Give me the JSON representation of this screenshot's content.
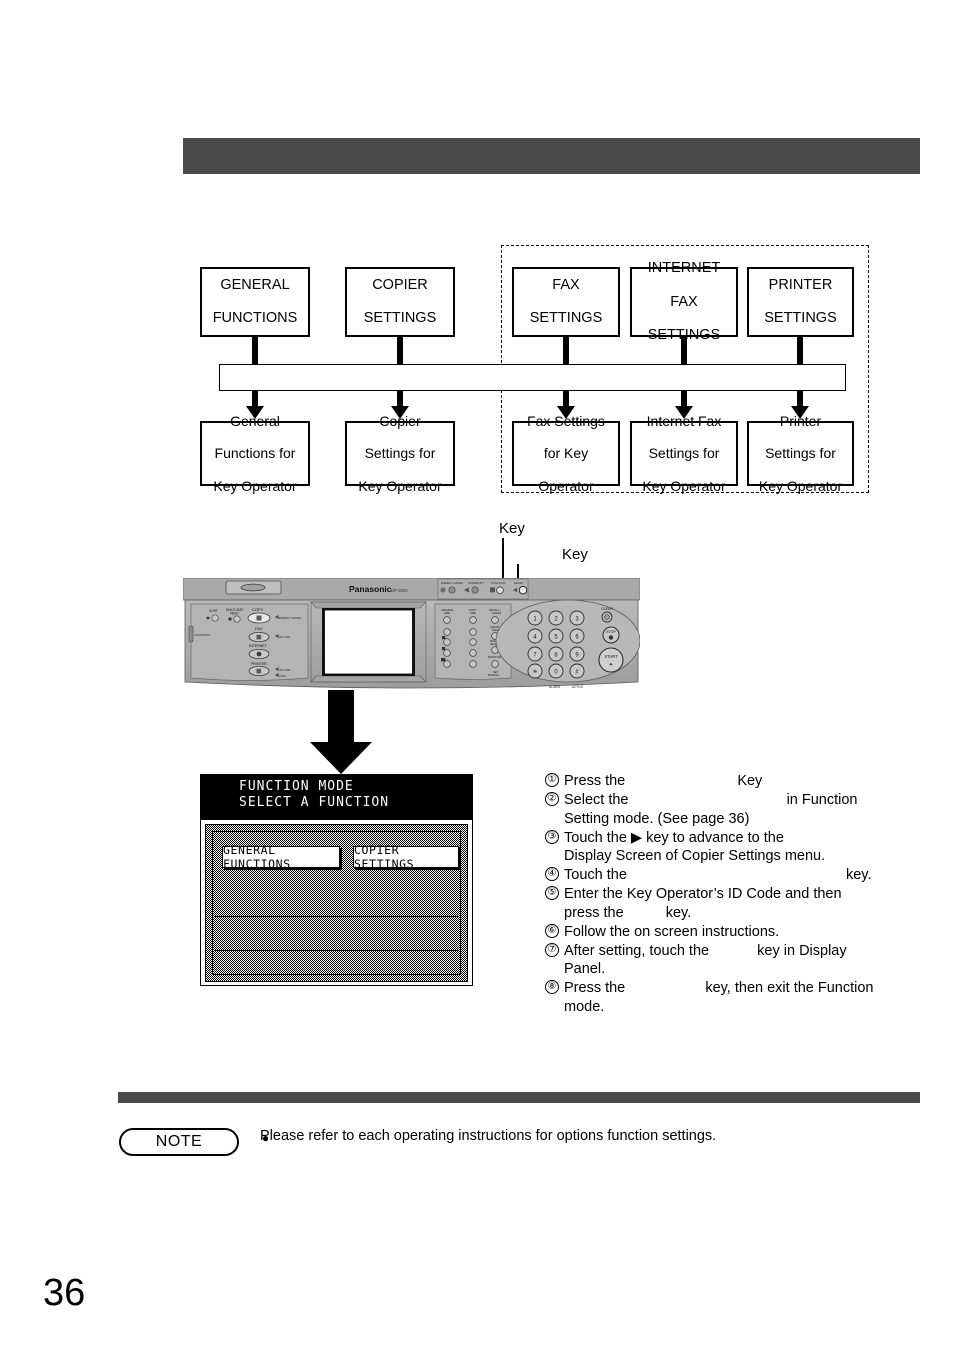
{
  "header": {
    "title": ""
  },
  "flowchart": {
    "top_boxes": [
      {
        "id": "general-functions",
        "lines": [
          "GENERAL",
          "FUNCTIONS"
        ]
      },
      {
        "id": "copier-settings",
        "lines": [
          "COPIER",
          "SETTINGS"
        ]
      },
      {
        "id": "fax-settings",
        "lines": [
          "FAX",
          "SETTINGS"
        ]
      },
      {
        "id": "internet-fax-settings",
        "lines": [
          "INTERNET",
          "FAX",
          "SETTINGS"
        ]
      },
      {
        "id": "printer-settings",
        "lines": [
          "PRINTER",
          "SETTINGS"
        ]
      }
    ],
    "bottom_boxes": [
      {
        "id": "general-functions-ko",
        "lines": [
          "General",
          "Functions for",
          "Key Operator"
        ]
      },
      {
        "id": "copier-settings-ko",
        "lines": [
          "Copier",
          "Settings for",
          "Key Operator"
        ]
      },
      {
        "id": "fax-settings-ko",
        "lines": [
          "Fax Settings",
          "for Key",
          "Operator"
        ]
      },
      {
        "id": "internet-fax-settings-ko",
        "lines": [
          "Internet Fax",
          "Settings for",
          "Key Operator"
        ]
      },
      {
        "id": "printer-settings-ko",
        "lines": [
          "Printer",
          "Settings for",
          "Key Operator"
        ]
      }
    ],
    "bus_label": ""
  },
  "callouts": {
    "function_key_label": "Key",
    "reset_key_label": "Key"
  },
  "panel": {
    "brand": "Panasonic",
    "model": "DP-3000",
    "mode_keys": [
      "COPY",
      "FAX",
      "INTERNET",
      "PRINTER"
    ],
    "left_indicators": [
      "SORT",
      "MULTI-SIZE FEED"
    ],
    "top_right_keys": [
      "ENERGY SAVER",
      "INTERRUPT",
      "FUNCTION",
      "RESET"
    ],
    "keypad": [
      "1",
      "2",
      "3",
      "4",
      "5",
      "6",
      "7",
      "8",
      "9",
      "∗",
      "0",
      "#"
    ],
    "clear_label": "CLEAR",
    "stop_label": "STOP",
    "start_label": "START",
    "status_labels": [
      "ALARM",
      "ACTIVE"
    ]
  },
  "lcd": {
    "title_line1": "FUNCTION MODE",
    "title_line2": "SELECT A FUNCTION",
    "buttons": [
      "GENERAL FUNCTIONS",
      "COPIER SETTINGS"
    ]
  },
  "steps": [
    {
      "num": "①",
      "parts": [
        "Press the",
        "",
        "Key"
      ]
    },
    {
      "num": "②",
      "parts": [
        "Select the",
        "",
        "in Function"
      ],
      "cont": "Setting mode. (See page 36)"
    },
    {
      "num": "③",
      "parts": [
        "Touch the ▶ key to advance to the"
      ],
      "cont": "Display Screen of Copier Settings menu."
    },
    {
      "num": "④",
      "parts": [
        "Touch the",
        "",
        "key."
      ]
    },
    {
      "num": "⑤",
      "parts": [
        "Enter the Key Operator’s ID Code and then"
      ],
      "cont_parts": [
        "press the",
        "",
        "key."
      ]
    },
    {
      "num": "⑥",
      "parts": [
        "Follow the on screen instructions."
      ]
    },
    {
      "num": "⑦",
      "parts": [
        "After setting, touch the",
        "",
        "key in Display"
      ],
      "cont": "Panel."
    },
    {
      "num": "⑧",
      "parts": [
        "Press the",
        "",
        "key, then exit the Function"
      ],
      "cont": "mode."
    }
  ],
  "note": {
    "badge": "NOTE",
    "bullet": "●",
    "text": "Please refer to each operating instructions for options function settings."
  },
  "page_number": "36"
}
